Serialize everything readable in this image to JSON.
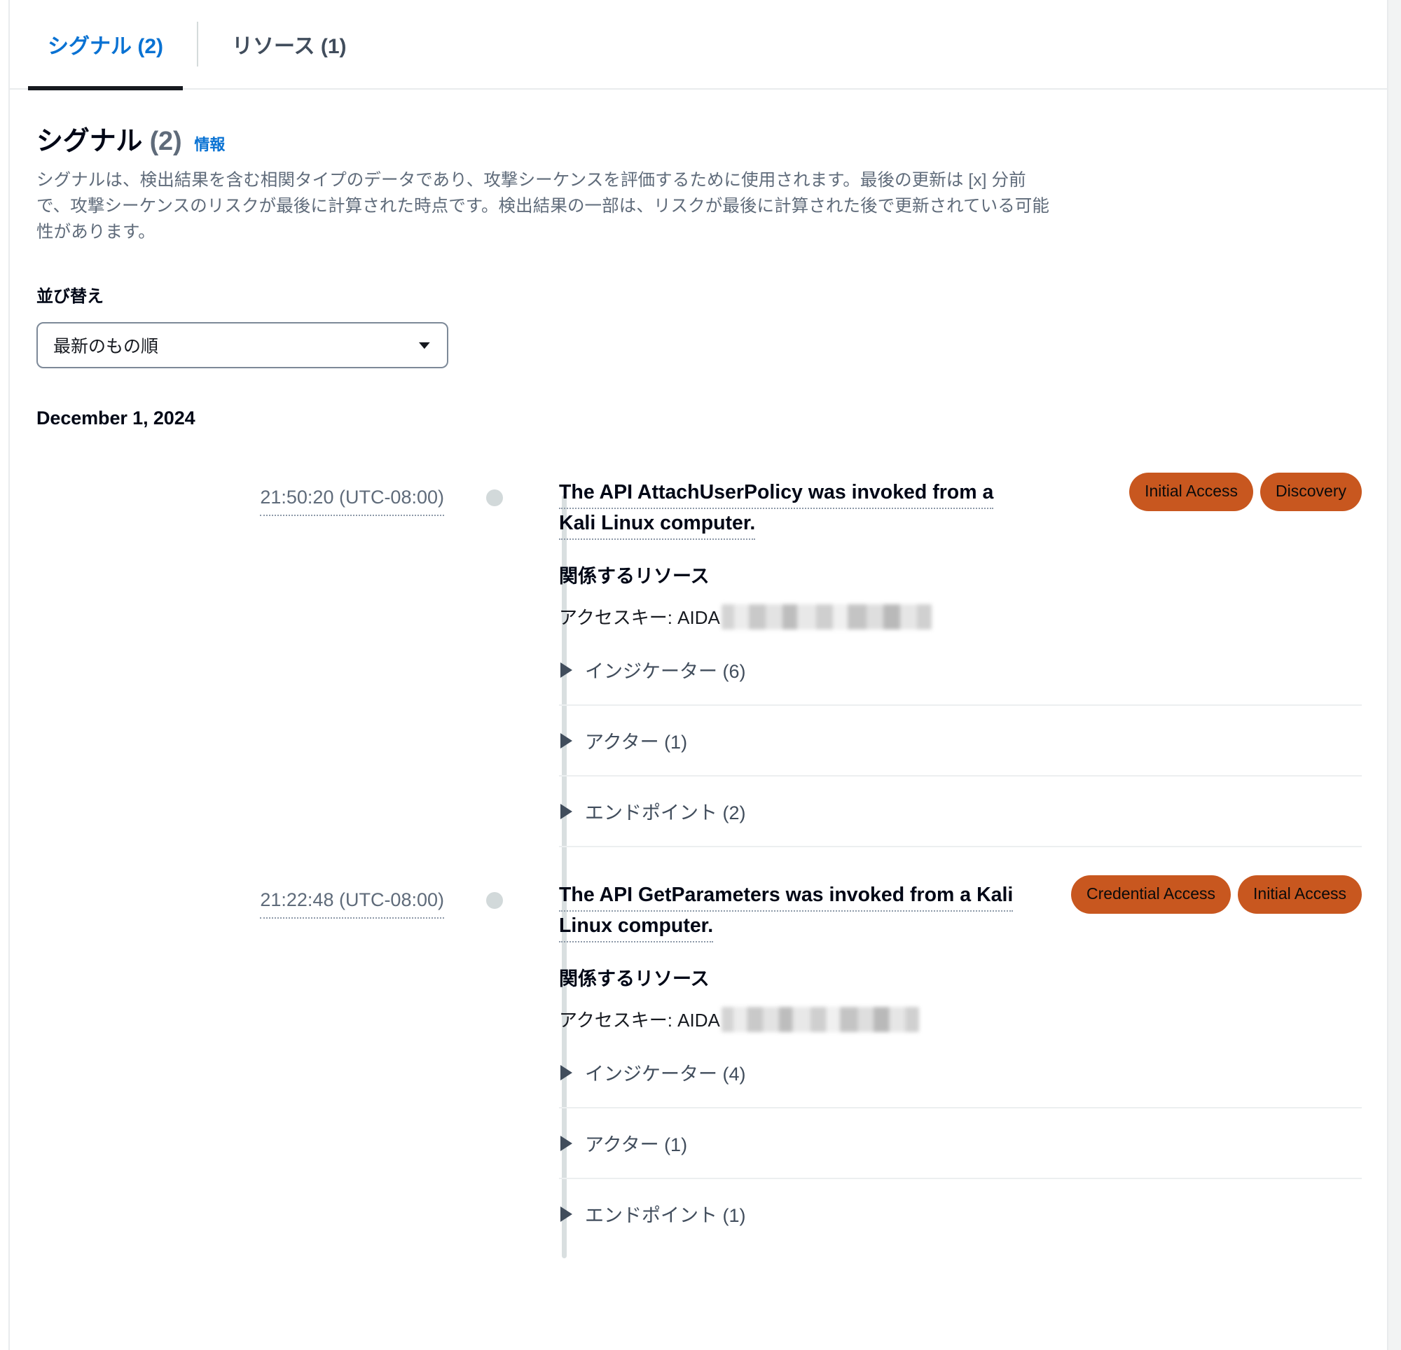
{
  "tabs": [
    {
      "label": "シグナル (2)",
      "active": true
    },
    {
      "label": "リソース (1)",
      "active": false
    }
  ],
  "section": {
    "title": "シグナル",
    "count": "(2)",
    "info_label": "情報",
    "description": "シグナルは、検出結果を含む相関タイプのデータであり、攻撃シーケンスを評価するために使用されます。最後の更新は [x] 分前で、攻撃シーケンスのリスクが最後に計算された時点です。検出結果の一部は、リスクが最後に計算された後で更新されている可能性があります。"
  },
  "sort": {
    "label": "並び替え",
    "selected": "最新のもの順",
    "caret_icon": "▼"
  },
  "date_group": {
    "label": "December 1, 2024"
  },
  "colors": {
    "accent_link": "#0972d3",
    "badge_bg": "#c8571f",
    "timeline": "#d9dfe0"
  },
  "signals": [
    {
      "time": "21:50:20 (UTC-08:00)",
      "title": "The API AttachUserPolicy was invoked from a Kali Linux computer.",
      "badges": [
        "Initial Access",
        "Discovery"
      ],
      "resources_heading": "関係するリソース",
      "resource_label": "アクセスキー: AIDA",
      "resource_redacted": true,
      "expanders": [
        {
          "label": "インジケーター (6)"
        },
        {
          "label": "アクター (1)"
        },
        {
          "label": "エンドポイント (2)"
        }
      ]
    },
    {
      "time": "21:22:48 (UTC-08:00)",
      "title": "The API GetParameters was invoked from a Kali Linux computer.",
      "badges": [
        "Credential Access",
        "Initial Access"
      ],
      "resources_heading": "関係するリソース",
      "resource_label": "アクセスキー: AIDA",
      "resource_redacted": true,
      "expanders": [
        {
          "label": "インジケーター (4)"
        },
        {
          "label": "アクター (1)"
        },
        {
          "label": "エンドポイント (1)"
        }
      ]
    }
  ]
}
